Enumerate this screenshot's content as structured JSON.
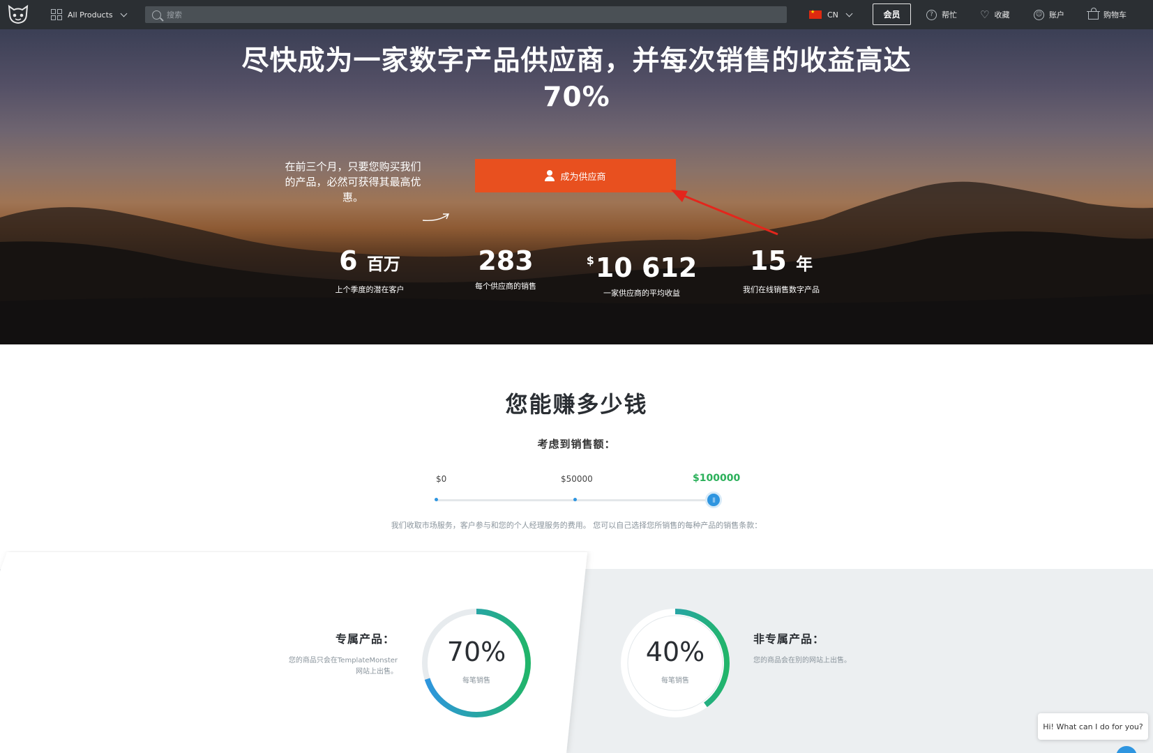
{
  "nav": {
    "all_products": "All Products",
    "search_placeholder": "搜索",
    "lang": "CN",
    "member": "会员",
    "help": "帮忙",
    "favorites": "收藏",
    "account": "账户",
    "cart": "购物车"
  },
  "hero": {
    "title_line1": "尽快成为一家数字产品供应商，并每次销售的收益高达",
    "title_line2": "70%",
    "note": "在前三个月，只要您购买我们的产品，必然可获得其最高优惠。",
    "cta": "成为供应商",
    "stats": [
      {
        "value": "6",
        "unit": "百万",
        "label": "上个季度的潜在客户"
      },
      {
        "value": "283",
        "unit": "",
        "label": "每个供应商的销售"
      },
      {
        "currency": "$",
        "value": "10 612",
        "unit": "",
        "label": "一家供应商的平均收益"
      },
      {
        "value": "15",
        "unit": "年",
        "label": "我们在线销售数字产品"
      }
    ]
  },
  "earnings": {
    "title": "您能赚多少钱",
    "subtitle": "考虑到销售额：",
    "slider": {
      "ticks": [
        "$0",
        "$50000",
        "$100000"
      ],
      "selected": "$100000",
      "value_fraction": 1.0
    },
    "note": "我们收取市场服务，客户参与和您的个人经理服务的费用。 您可以自己选择您所销售的每种产品的销售条款："
  },
  "products": {
    "exclusive": {
      "title": "专属产品：",
      "desc_line1": "您的商品只会在TemplateMonster",
      "desc_line2": "网站上出售。",
      "percent": "70%",
      "percent_value": 70,
      "ring_label": "每笔销售"
    },
    "non_exclusive": {
      "title": "非专属产品：",
      "desc": "您的商品会在别的网站上出售。",
      "percent": "40%",
      "percent_value": 40,
      "ring_label": "每笔销售"
    }
  },
  "chat": {
    "text": "Hi! What can I do for you?"
  },
  "colors": {
    "nav_bg": "#2b2f33",
    "cta_orange": "#e8501f",
    "accent_blue": "#2e95e0",
    "accent_green": "#2bb05a",
    "annotation_red": "#e3261c",
    "panel_grey": "#eceff1"
  }
}
